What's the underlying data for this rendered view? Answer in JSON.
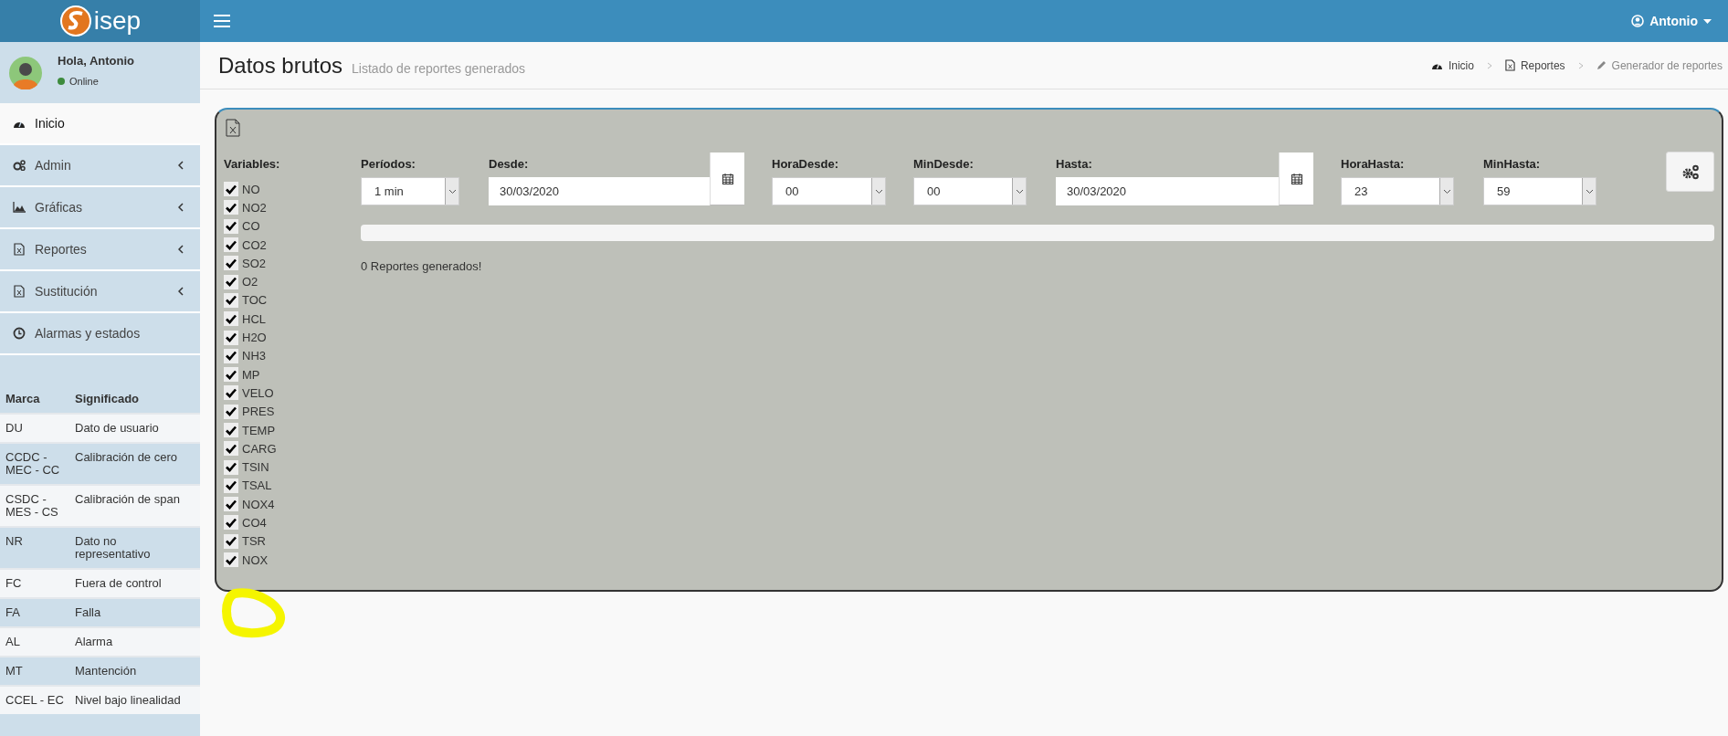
{
  "topbar": {
    "brand": "isep",
    "user": "Antonio"
  },
  "sidebar": {
    "greeting": "Hola, Antonio",
    "status": "Online",
    "menu": [
      {
        "label": "Inicio",
        "selected": true,
        "expandable": false
      },
      {
        "label": "Admin",
        "selected": false,
        "expandable": true
      },
      {
        "label": "Gráficas",
        "selected": false,
        "expandable": true
      },
      {
        "label": "Reportes",
        "selected": false,
        "expandable": true
      },
      {
        "label": "Sustitución",
        "selected": false,
        "expandable": true
      },
      {
        "label": "Alarmas y estados",
        "selected": false,
        "expandable": false
      }
    ],
    "legend": {
      "columns": [
        "Marca",
        "Significado"
      ],
      "rows": [
        [
          "DU",
          "Dato de usuario"
        ],
        [
          "CCDC - MEC - CC",
          "Calibración de cero"
        ],
        [
          "CSDC - MES - CS",
          "Calibración de span"
        ],
        [
          "NR",
          "Dato no representativo"
        ],
        [
          "FC",
          "Fuera de control"
        ],
        [
          "FA",
          "Falla"
        ],
        [
          "AL",
          "Alarma"
        ],
        [
          "MT",
          "Mantención"
        ],
        [
          "CCEL - EC",
          "Nivel bajo linealidad"
        ]
      ]
    }
  },
  "header": {
    "title": "Datos brutos",
    "subtitle": "Listado de reportes generados",
    "breadcrumb": [
      {
        "label": "Inicio",
        "current": false
      },
      {
        "label": "Reportes",
        "current": false
      },
      {
        "label": "Generador de reportes",
        "current": true
      }
    ]
  },
  "form": {
    "variables_label": "Variables:",
    "variables": [
      {
        "name": "NO",
        "checked": true
      },
      {
        "name": "NO2",
        "checked": true
      },
      {
        "name": "CO",
        "checked": true
      },
      {
        "name": "CO2",
        "checked": true
      },
      {
        "name": "SO2",
        "checked": true
      },
      {
        "name": "O2",
        "checked": true
      },
      {
        "name": "TOC",
        "checked": true
      },
      {
        "name": "HCL",
        "checked": true
      },
      {
        "name": "H2O",
        "checked": true
      },
      {
        "name": "NH3",
        "checked": true
      },
      {
        "name": "MP",
        "checked": true
      },
      {
        "name": "VELO",
        "checked": true
      },
      {
        "name": "PRES",
        "checked": true
      },
      {
        "name": "TEMP",
        "checked": true
      },
      {
        "name": "CARG",
        "checked": true
      },
      {
        "name": "TSIN",
        "checked": true
      },
      {
        "name": "TSAL",
        "checked": true
      },
      {
        "name": "NOX4",
        "checked": true
      },
      {
        "name": "CO4",
        "checked": true
      },
      {
        "name": "TSR",
        "checked": true
      },
      {
        "name": "NOX",
        "checked": true
      }
    ],
    "fields": [
      {
        "kind": "select",
        "label": "Períodos:",
        "value": "1 min"
      },
      {
        "kind": "date",
        "label": "Desde:",
        "value": "30/03/2020"
      },
      {
        "kind": "select",
        "label": "HoraDesde:",
        "value": "00"
      },
      {
        "kind": "select",
        "label": "MinDesde:",
        "value": "00"
      },
      {
        "kind": "date",
        "label": "Hasta:",
        "value": "30/03/2020"
      },
      {
        "kind": "select",
        "label": "HoraHasta:",
        "value": "23"
      },
      {
        "kind": "select",
        "label": "MinHasta:",
        "value": "59"
      }
    ],
    "progress": {
      "level": 0
    },
    "status": "0 Reportes generados!"
  }
}
